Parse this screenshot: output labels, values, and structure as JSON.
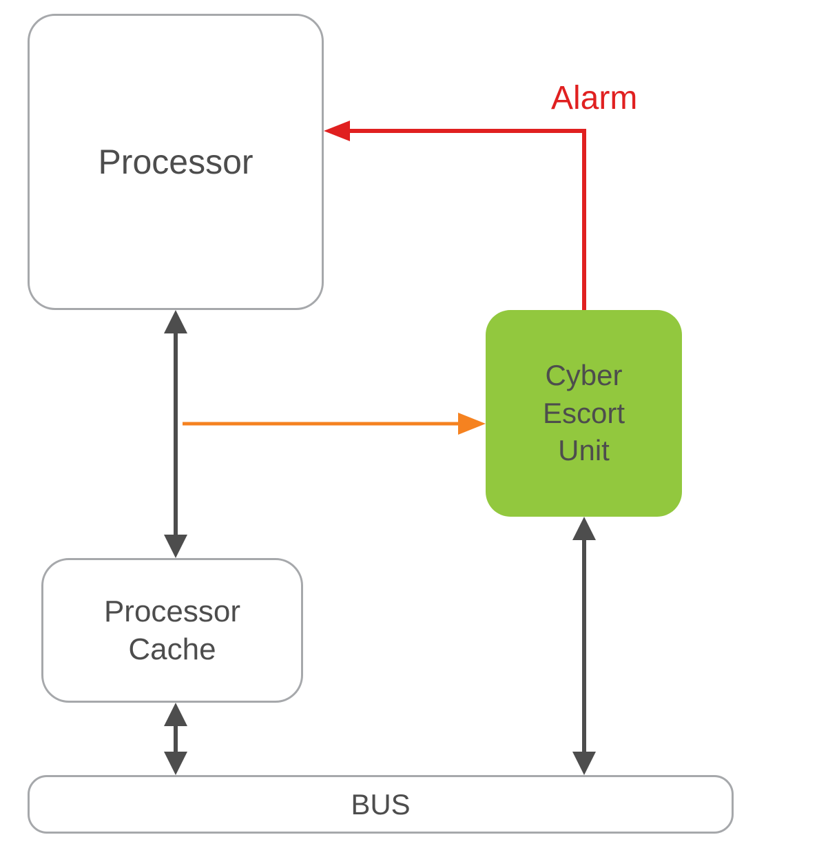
{
  "nodes": {
    "processor": {
      "label": "Processor"
    },
    "ceu": {
      "label_line1": "Cyber",
      "label_line2": "Escort",
      "label_line3": "Unit"
    },
    "cache": {
      "label_line1": "Processor",
      "label_line2": "Cache"
    },
    "bus": {
      "label": "BUS"
    }
  },
  "labels": {
    "alarm": "Alarm"
  },
  "colors": {
    "box_border": "#a6a8ab",
    "text": "#4d4d4d",
    "ceu_fill": "#92c83e",
    "arrow_gray": "#4d4d4d",
    "arrow_orange": "#f58220",
    "arrow_red": "#e02020"
  },
  "connections": [
    {
      "from": "processor",
      "to": "cache",
      "type": "bidirectional",
      "color": "gray"
    },
    {
      "from": "cache",
      "to": "bus",
      "type": "bidirectional",
      "color": "gray"
    },
    {
      "from": "ceu",
      "to": "bus",
      "type": "bidirectional",
      "color": "gray"
    },
    {
      "from": "processor-cache-link",
      "to": "ceu",
      "type": "unidirectional",
      "color": "orange"
    },
    {
      "from": "ceu",
      "to": "processor",
      "type": "unidirectional",
      "color": "red",
      "label": "Alarm"
    }
  ]
}
